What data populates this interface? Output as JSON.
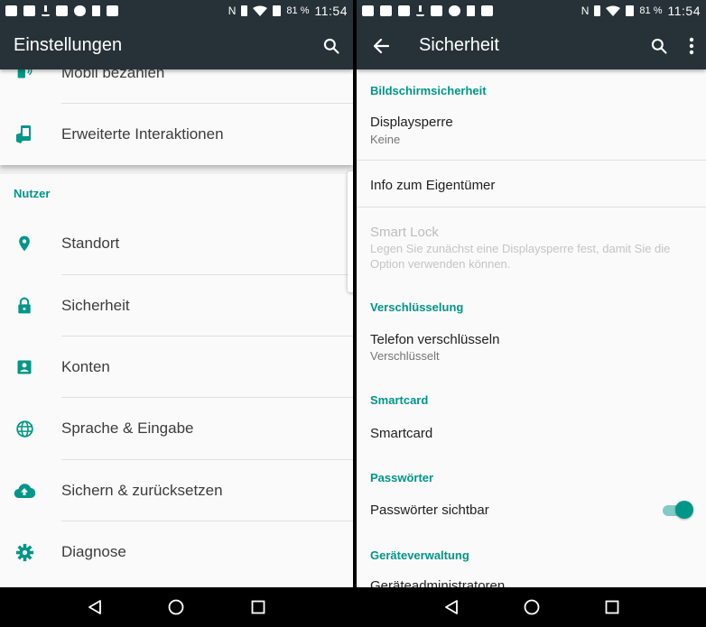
{
  "colors": {
    "accent": "#009688",
    "appbar": "#263238",
    "text": "#212121",
    "secondary": "#757575",
    "disabled": "#bdbdbd"
  },
  "status_bar": {
    "battery": "81 %",
    "time": "11:54",
    "icons": [
      "notification-icon",
      "mail-icon",
      "image-icon",
      "download-icon",
      "image-icon",
      "shield-icon",
      "note-icon",
      "check-icon",
      "nfc-icon",
      "vibrate-icon",
      "wifi-icon",
      "no-sim-icon",
      "battery-icon"
    ]
  },
  "left": {
    "appbar": {
      "title": "Einstellungen"
    },
    "items_top": [
      {
        "label": "Mobil bezahlen",
        "icon": "tap-pay-icon"
      },
      {
        "label": "Erweiterte Interaktionen",
        "icon": "gesture-icon"
      }
    ],
    "section": "Nutzer",
    "items": [
      {
        "label": "Standort",
        "icon": "location-icon"
      },
      {
        "label": "Sicherheit",
        "icon": "lock-icon"
      },
      {
        "label": "Konten",
        "icon": "account-icon"
      },
      {
        "label": "Sprache & Eingabe",
        "icon": "globe-icon"
      },
      {
        "label": "Sichern & zurücksetzen",
        "icon": "cloud-upload-icon"
      },
      {
        "label": "Diagnose",
        "icon": "gear-icon"
      }
    ]
  },
  "right": {
    "appbar": {
      "title": "Sicherheit"
    },
    "sections": {
      "screen": "Bildschirmsicherheit",
      "encryption": "Verschlüsselung",
      "smartcard": "Smartcard",
      "passwords": "Passwörter",
      "device_admin": "Geräteverwaltung"
    },
    "items": {
      "display_lock": {
        "title": "Displaysperre",
        "summary": "Keine"
      },
      "owner_info": {
        "title": "Info zum Eigentümer"
      },
      "smart_lock": {
        "title": "Smart Lock",
        "summary": "Legen Sie zunächst eine Displaysperre fest, damit Sie die Option verwenden können."
      },
      "encrypt_phone": {
        "title": "Telefon verschlüsseln",
        "summary": "Verschlüsselt"
      },
      "smartcard": {
        "title": "Smartcard"
      },
      "show_passwords": {
        "title": "Passwörter sichtbar",
        "enabled": true
      },
      "device_admins": {
        "title": "Geräteadministratoren"
      }
    }
  }
}
